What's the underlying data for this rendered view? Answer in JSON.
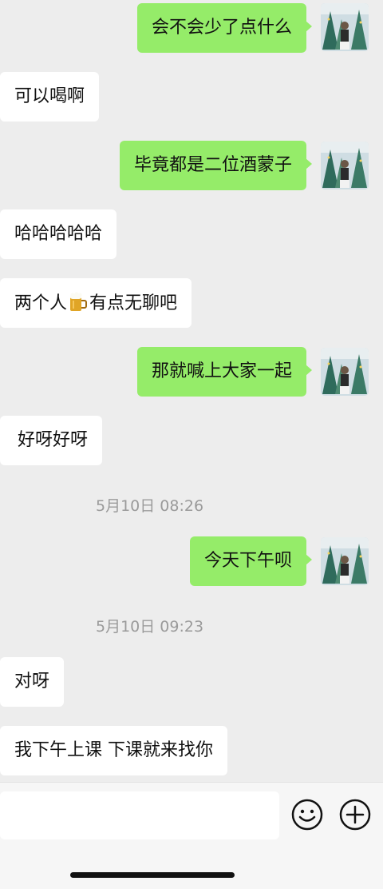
{
  "messages": [
    {
      "dir": "out",
      "text": "会不会少了点什么"
    },
    {
      "dir": "in",
      "text": "可以喝啊"
    },
    {
      "dir": "out",
      "text": "毕竟都是二位酒蒙子"
    },
    {
      "dir": "in",
      "text": "哈哈哈哈哈"
    },
    {
      "dir": "in",
      "text_before": "两个人",
      "emoji": "beer-mug",
      "text_after": "有点无聊吧"
    },
    {
      "dir": "out",
      "text": "那就喊上大家一起"
    },
    {
      "dir": "in",
      "text": "好呀好呀"
    },
    {
      "timestamp": "5月10日 08:26"
    },
    {
      "dir": "out",
      "text": "今天下午呗"
    },
    {
      "timestamp": "5月10日 09:23"
    },
    {
      "dir": "in",
      "text": "对呀"
    },
    {
      "dir": "in",
      "text": "我下午上课 下课就来找你"
    }
  ],
  "input_bar": {
    "placeholder": "",
    "emoji_icon": "smiley-icon",
    "more_icon": "plus-circle-icon"
  },
  "colors": {
    "outgoing_bubble": "#95ec69",
    "incoming_bubble": "#ffffff",
    "background": "#ededed"
  }
}
